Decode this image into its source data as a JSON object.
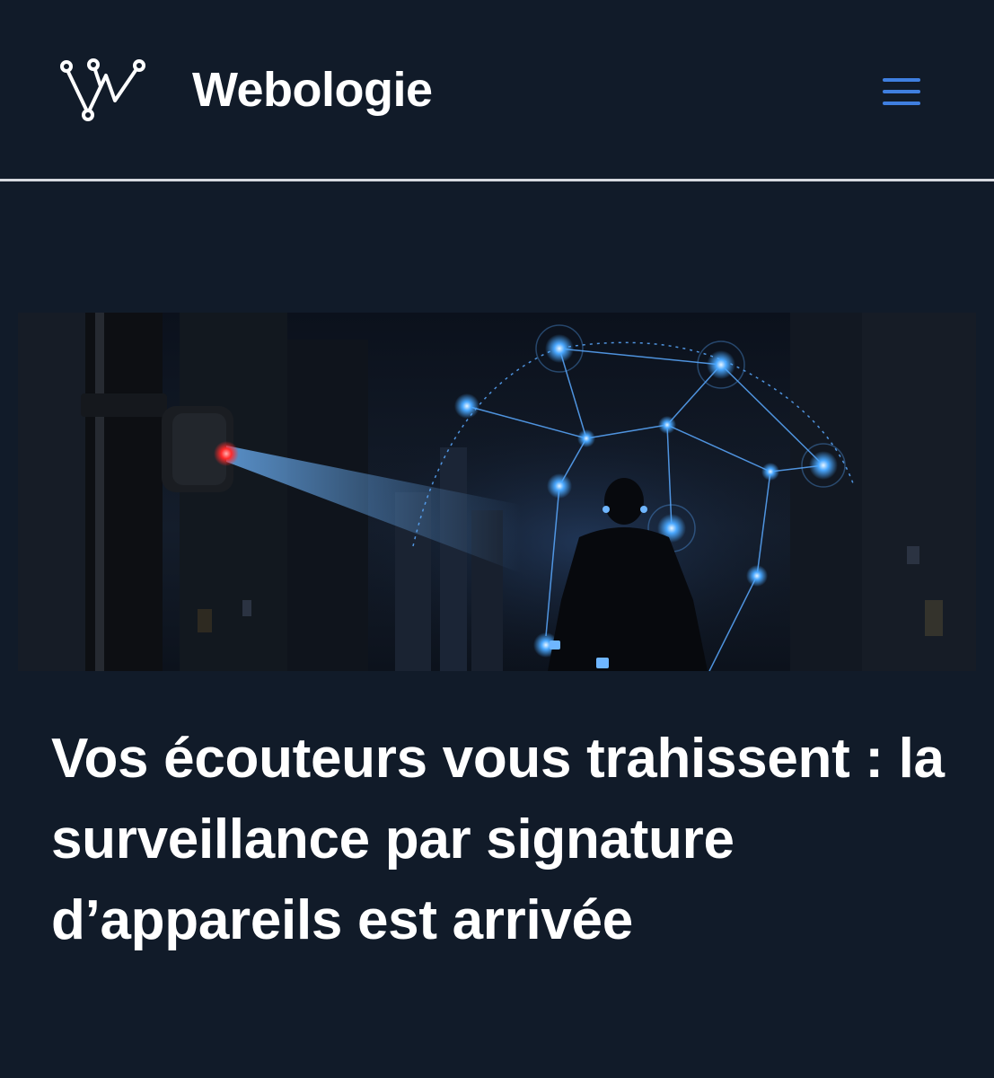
{
  "header": {
    "brand": "Webologie",
    "logo_icon": "webologie-logo-icon",
    "menu_icon": "hamburger-menu-icon",
    "menu_color": "#3f7fe0"
  },
  "hero": {
    "image_subject": "hero-image"
  },
  "article": {
    "title": "Vos écouteurs vous trahissent : la surveillance par signature d’appareils est arrivée"
  },
  "colors": {
    "background": "#111b29",
    "divider": "#d6d9de",
    "accent_glow": "#4aa8ff",
    "camera_led": "#ff2a2a"
  }
}
